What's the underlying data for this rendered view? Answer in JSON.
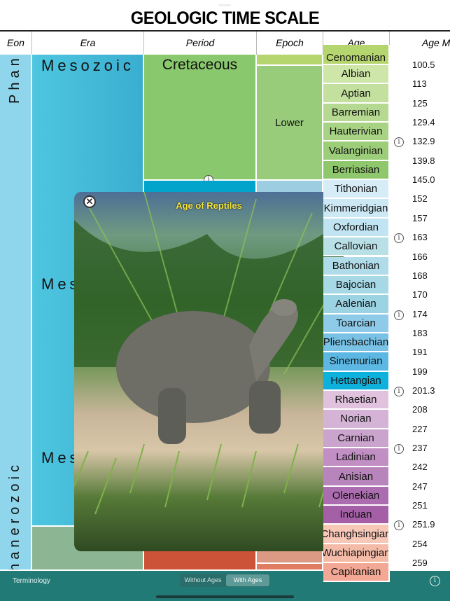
{
  "title": "GEOLOGIC TIME SCALE",
  "headers": {
    "eon": "Eon",
    "era": "Era",
    "period": "Period",
    "epoch": "Epoch",
    "age": "Age",
    "ma": "Age Ma"
  },
  "eon": {
    "top_label": "Phan",
    "label": "Phanerozoic"
  },
  "era": {
    "top_label": "Mesozoic",
    "mid_label": "Mes",
    "low_label": "Mes"
  },
  "period": {
    "cretaceous": "Cretaceous"
  },
  "epoch": {
    "lower": "Lower"
  },
  "ages": [
    {
      "name": "Cenomanian",
      "color": "#b5d56e"
    },
    {
      "name": "Albian",
      "color": "#cfe6a9"
    },
    {
      "name": "Aptian",
      "color": "#c4e09e"
    },
    {
      "name": "Barremian",
      "color": "#b6d991"
    },
    {
      "name": "Hauterivian",
      "color": "#a9d384"
    },
    {
      "name": "Valanginian",
      "color": "#9ccd78"
    },
    {
      "name": "Berriasian",
      "color": "#8fc76c"
    },
    {
      "name": "Tithonian",
      "color": "#d6ecf7"
    },
    {
      "name": "Kimmeridgian",
      "color": "#cce8f4"
    },
    {
      "name": "Oxfordian",
      "color": "#c1e4f2"
    },
    {
      "name": "Callovian",
      "color": "#b9e0e6"
    },
    {
      "name": "Bathonian",
      "color": "#b0dcea"
    },
    {
      "name": "Bajocian",
      "color": "#a6d8e6"
    },
    {
      "name": "Aalenian",
      "color": "#9bd3e2"
    },
    {
      "name": "Toarcian",
      "color": "#8dcbe9"
    },
    {
      "name": "Pliensbachian",
      "color": "#79c2e6"
    },
    {
      "name": "Sinemurian",
      "color": "#5cb8e3"
    },
    {
      "name": "Hettangian",
      "color": "#0eb0dc"
    },
    {
      "name": "Rhaetian",
      "color": "#e0c2de"
    },
    {
      "name": "Norian",
      "color": "#d5b3d6"
    },
    {
      "name": "Carnian",
      "color": "#caa4cd"
    },
    {
      "name": "Ladinian",
      "color": "#c28fc4"
    },
    {
      "name": "Anisian",
      "color": "#b884bc"
    },
    {
      "name": "Olenekian",
      "color": "#ac6db0"
    },
    {
      "name": "Induan",
      "color": "#a45fa6"
    },
    {
      "name": "Changhsingian",
      "color": "#f7c7b7"
    },
    {
      "name": "Wuchiapingian",
      "color": "#f5bba9"
    },
    {
      "name": "Capitanian",
      "color": "#f2a894"
    }
  ],
  "ma_values": [
    "100.5",
    "113",
    "125",
    "129.4",
    "132.9",
    "139.8",
    "145.0",
    "152",
    "157",
    "163",
    "166",
    "168",
    "170",
    "174",
    "183",
    "191",
    "199",
    "201.3",
    "208",
    "227",
    "237",
    "242",
    "247",
    "251",
    "251.9",
    "254",
    "259"
  ],
  "info_at": [
    "132.9",
    "163",
    "174",
    "201.3",
    "237",
    "251.9"
  ],
  "popup": {
    "title": "Age of Reptiles",
    "title_color": "#f5e63c"
  },
  "bottom": {
    "terminology": "Terminology",
    "without_ages": "Without Ages",
    "with_ages": "With Ages",
    "bar_color": "#217a76"
  }
}
